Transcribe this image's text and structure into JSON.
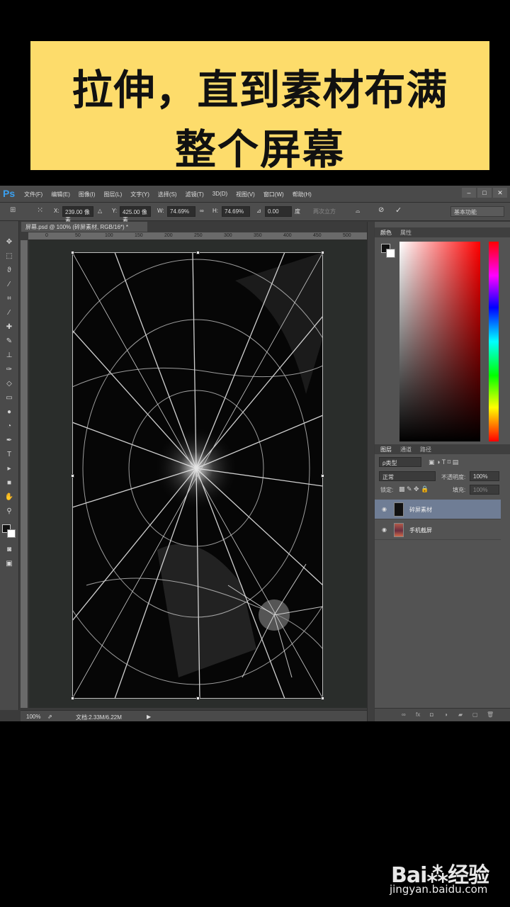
{
  "banner": {
    "line1": "拉伸，直到素材布满",
    "line2": "整个屏幕"
  },
  "app": {
    "logo": "Ps",
    "menu": [
      "文件(F)",
      "编辑(E)",
      "图像(I)",
      "图层(L)",
      "文字(Y)",
      "选择(S)",
      "滤镜(T)",
      "3D(D)",
      "视图(V)",
      "窗口(W)",
      "帮助(H)"
    ],
    "window_controls": [
      "–",
      "□",
      "✕"
    ]
  },
  "options": {
    "x_label": "X:",
    "x_value": "239.00 像素",
    "y_label": "Y:",
    "y_value": "425.00 像素",
    "w_label": "W:",
    "w_value": "74.69%",
    "h_label": "H:",
    "h_value": "74.69%",
    "angle_value": "0.00",
    "angle_unit": "度",
    "interp_label": "两次立方",
    "workspace": "基本功能"
  },
  "document": {
    "tab_title": "屏幕.psd @ 100% (碎屏素材, RGB/16*) *",
    "ruler_ticks": [
      "0",
      "50",
      "100",
      "150",
      "200",
      "250",
      "300",
      "350",
      "400",
      "450",
      "500"
    ],
    "zoom": "100%",
    "doc_size": "文档:2.33M/6.22M"
  },
  "panels": {
    "color_tabs": [
      "颜色",
      "属性"
    ],
    "layer_tabs": [
      "图层",
      "通道",
      "路径"
    ],
    "filter_kind": "ρ类型",
    "blend_mode": "正常",
    "opacity_label": "不透明度:",
    "opacity_value": "100%",
    "lock_label": "锁定:",
    "fill_label": "填充:",
    "fill_value": "100%",
    "layers": [
      {
        "name": "碎屏素材",
        "selected": true
      },
      {
        "name": "手机截屏",
        "selected": false
      }
    ]
  },
  "watermark": {
    "logo": "Bai⁂经验",
    "url": "jingyan.baidu.com"
  }
}
